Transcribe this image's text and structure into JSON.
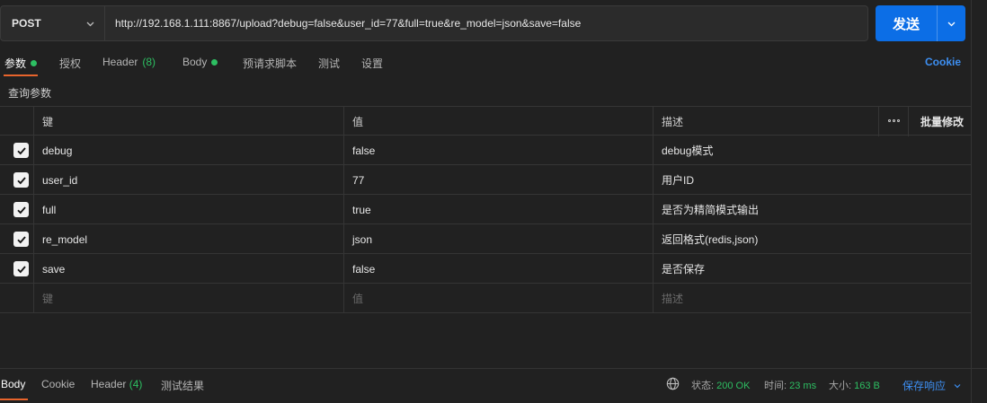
{
  "request": {
    "method": "POST",
    "url": "http://192.168.1.111:8867/upload?debug=false&user_id=77&full=true&re_model=json&save=false",
    "send_label": "发送"
  },
  "tabs": [
    {
      "label": "参数",
      "dot": true
    },
    {
      "label": "授权"
    },
    {
      "label": "Header",
      "count": "(8)"
    },
    {
      "label": "Body",
      "dot": true
    },
    {
      "label": "预请求脚本"
    },
    {
      "label": "测试"
    },
    {
      "label": "设置"
    }
  ],
  "cookie_link": "Cookie",
  "section_label": "查询参数",
  "table": {
    "headers": {
      "key": "键",
      "value": "值",
      "description": "描述",
      "bulk_edit": "批量修改"
    },
    "rows": [
      {
        "key": "debug",
        "value": "false",
        "description": "debug模式",
        "checked": true
      },
      {
        "key": "user_id",
        "value": "77",
        "description": "用户ID",
        "checked": true
      },
      {
        "key": "full",
        "value": "true",
        "description": "是否为精简模式输出",
        "checked": true
      },
      {
        "key": "re_model",
        "value": "json",
        "description": "返回格式(redis,json)",
        "checked": true
      },
      {
        "key": "save",
        "value": "false",
        "description": "是否保存",
        "checked": true
      }
    ],
    "placeholders": {
      "key": "键",
      "value": "值",
      "description": "描述"
    }
  },
  "response": {
    "tabs": [
      {
        "label": "Body"
      },
      {
        "label": "Cookie"
      },
      {
        "label": "Header",
        "count": "(4)"
      },
      {
        "label": "测试结果"
      }
    ],
    "status_label": "状态:",
    "status_value": "200 OK",
    "time_label": "时间:",
    "time_value": "23 ms",
    "size_label": "大小:",
    "size_value": "163 B",
    "save_label": "保存响应"
  },
  "colors": {
    "accent": "#0c6ee6",
    "tab_underline": "#e8642c",
    "success": "#2dbf62",
    "link": "#3d8ff2"
  }
}
